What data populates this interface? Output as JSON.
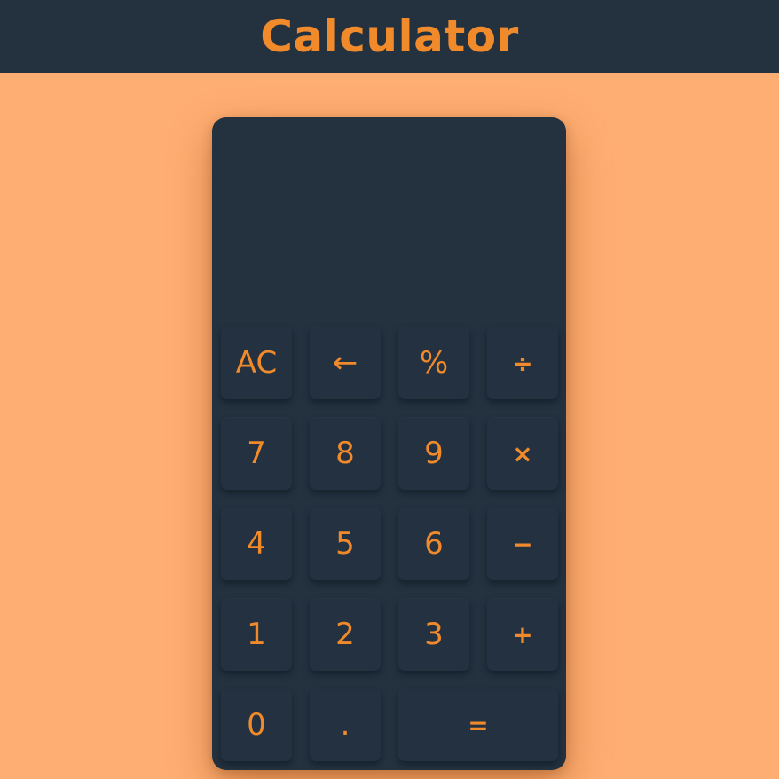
{
  "header": {
    "title": "Calculator"
  },
  "display": {
    "previous_operand": "",
    "current_operand": ""
  },
  "keys": {
    "all_clear": "AC",
    "backspace": "←",
    "percent": "%",
    "divide": "÷",
    "seven": "7",
    "eight": "8",
    "nine": "9",
    "multiply": "×",
    "four": "4",
    "five": "5",
    "six": "6",
    "subtract": "−",
    "one": "1",
    "two": "2",
    "three": "3",
    "add": "+",
    "zero": "0",
    "decimal": ".",
    "equals": "="
  },
  "colors": {
    "background": "#ffae73",
    "panel": "#243240",
    "accent": "#f08a2b"
  }
}
